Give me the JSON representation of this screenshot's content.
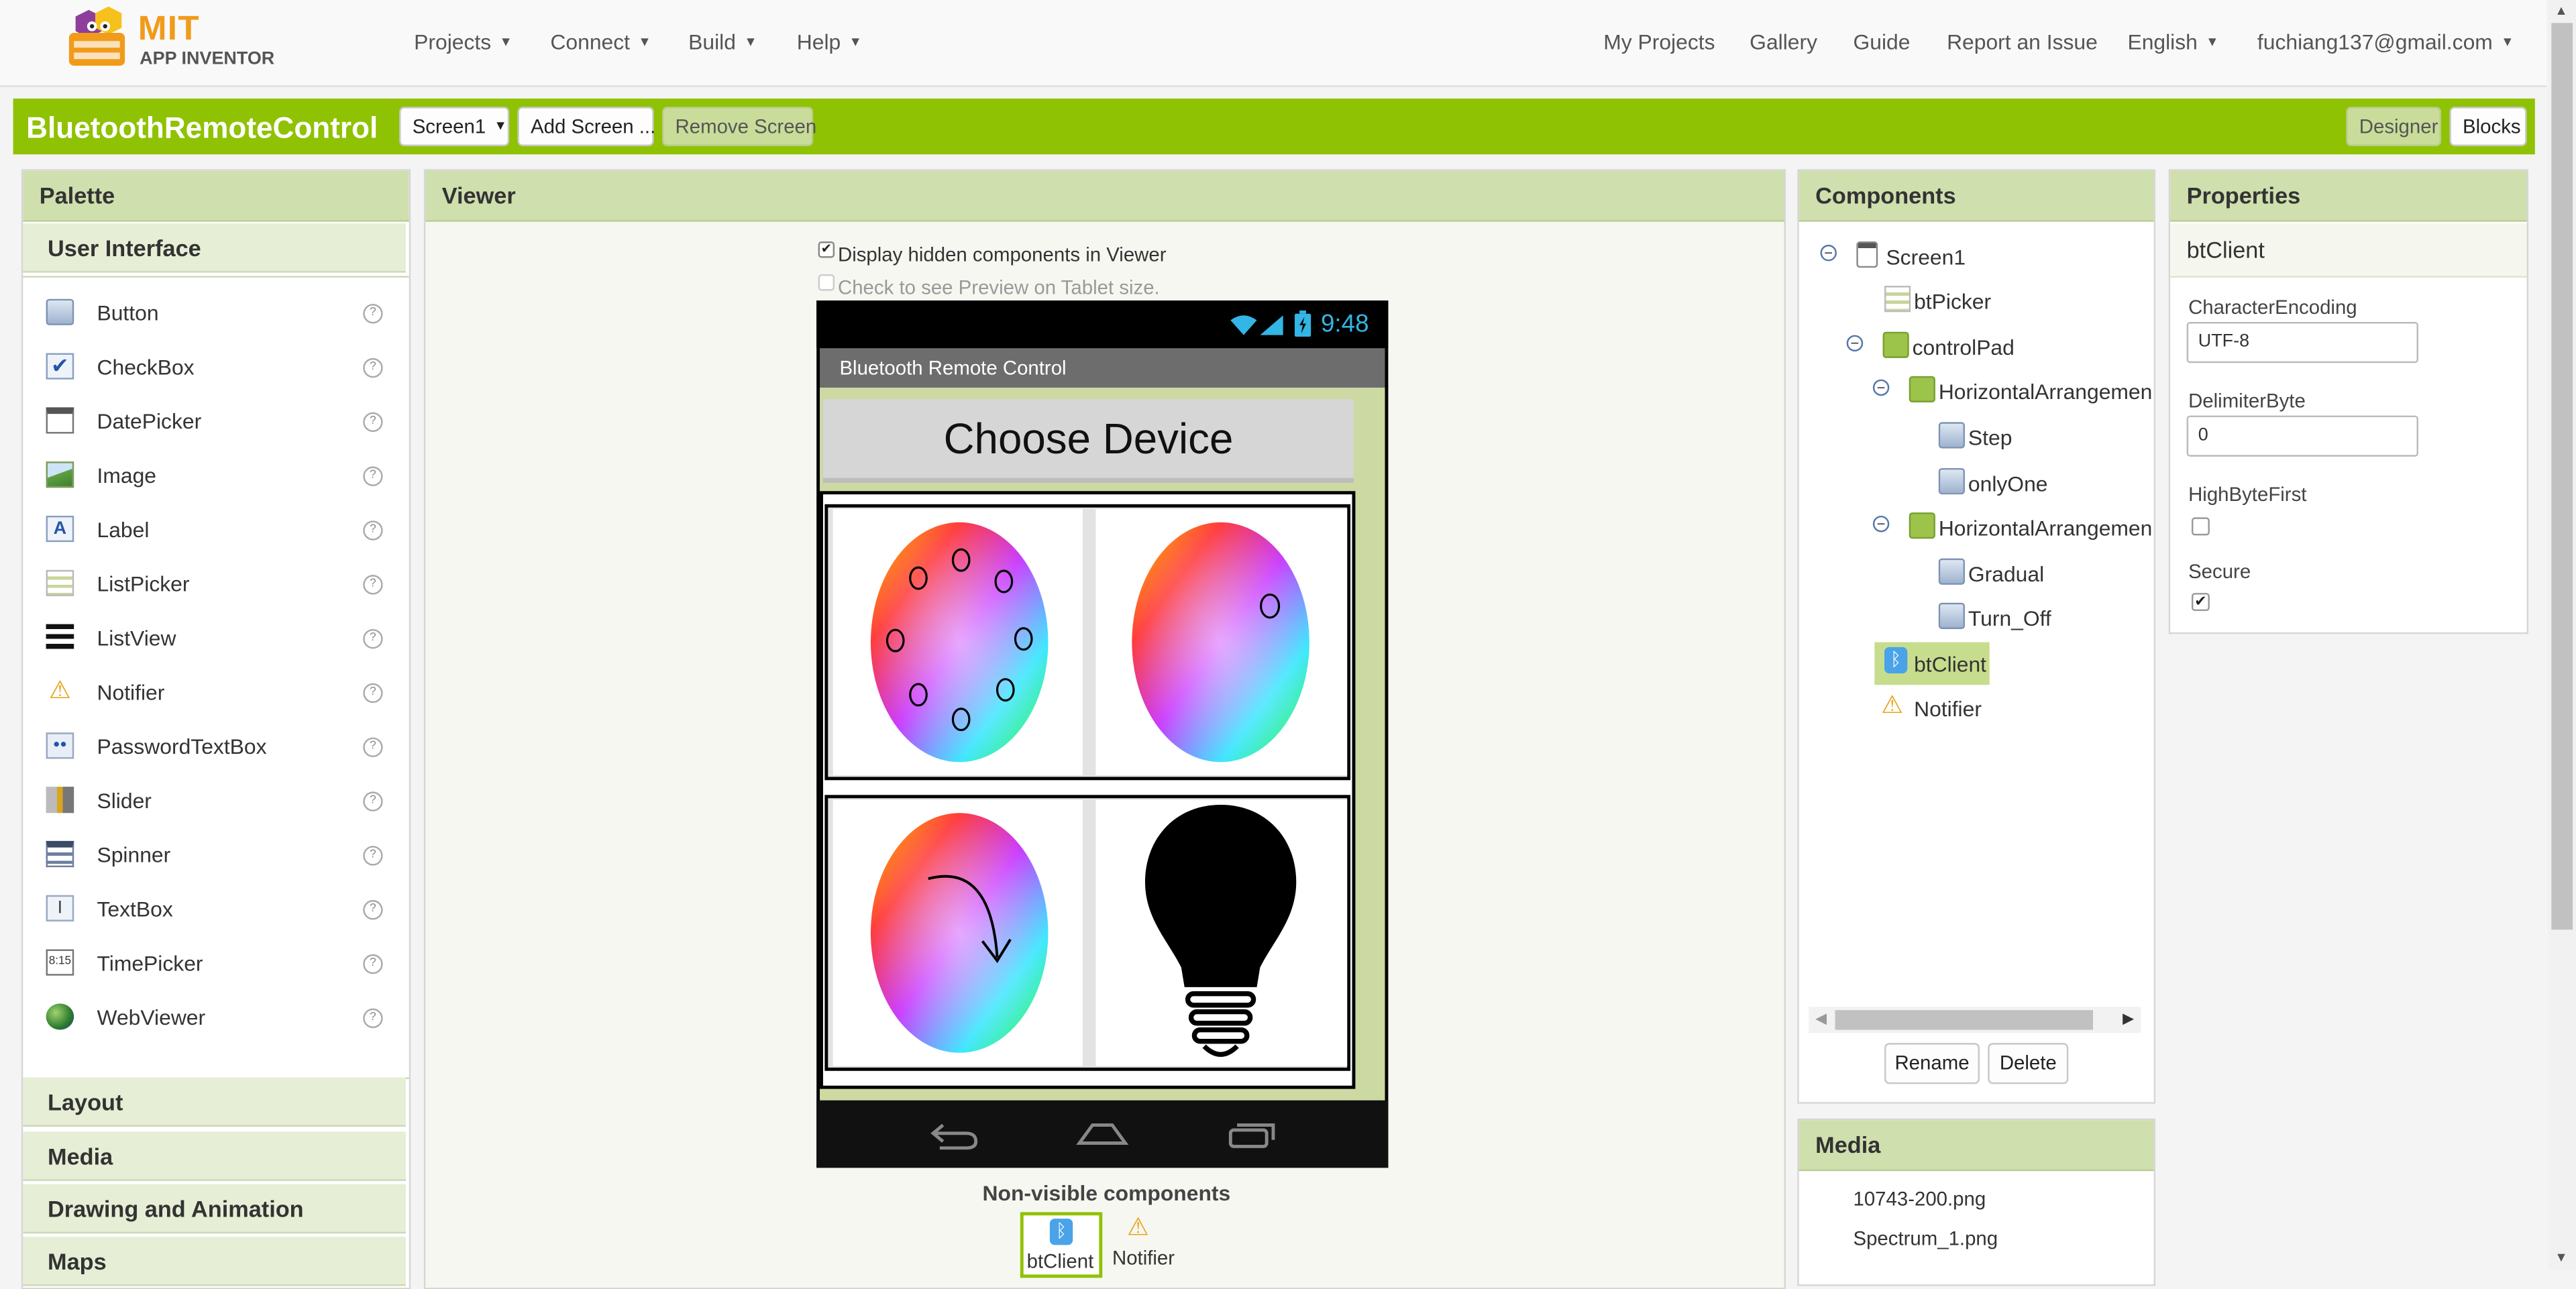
{
  "logo": {
    "line1": "MIT",
    "line2": "APP INVENTOR"
  },
  "topnav": {
    "menus": [
      "Projects",
      "Connect",
      "Build",
      "Help"
    ],
    "links": [
      "My Projects",
      "Gallery",
      "Guide",
      "Report an Issue"
    ],
    "language": "English",
    "account": "fuchiang137@gmail.com"
  },
  "project": {
    "name": "BluetoothRemoteControl",
    "screen_select": "Screen1",
    "add_screen": "Add Screen ...",
    "remove_screen": "Remove Screen",
    "designer": "Designer",
    "blocks": "Blocks"
  },
  "palette": {
    "title": "Palette",
    "open_category": "User Interface",
    "items": [
      {
        "label": "Button",
        "icon": "button-icon"
      },
      {
        "label": "CheckBox",
        "icon": "checkbox-icon"
      },
      {
        "label": "DatePicker",
        "icon": "datepicker-icon"
      },
      {
        "label": "Image",
        "icon": "image-icon"
      },
      {
        "label": "Label",
        "icon": "label-icon"
      },
      {
        "label": "ListPicker",
        "icon": "listpicker-icon"
      },
      {
        "label": "ListView",
        "icon": "listview-icon"
      },
      {
        "label": "Notifier",
        "icon": "notifier-icon"
      },
      {
        "label": "PasswordTextBox",
        "icon": "password-icon"
      },
      {
        "label": "Slider",
        "icon": "slider-icon"
      },
      {
        "label": "Spinner",
        "icon": "spinner-icon"
      },
      {
        "label": "TextBox",
        "icon": "textbox-icon"
      },
      {
        "label": "TimePicker",
        "icon": "timepicker-icon"
      },
      {
        "label": "WebViewer",
        "icon": "webviewer-icon"
      }
    ],
    "help_glyph": "?",
    "categories": [
      "Layout",
      "Media",
      "Drawing and Animation",
      "Maps"
    ]
  },
  "viewer": {
    "title": "Viewer",
    "display_hidden_label": "Display hidden components in Viewer",
    "display_hidden_checked": true,
    "tablet_preview_label": "Check to see Preview on Tablet size.",
    "tablet_preview_checked": false,
    "phone": {
      "time": "9:48",
      "app_title": "Bluetooth Remote Control",
      "button_text": "Choose Device"
    },
    "nonvisible_title": "Non-visible components",
    "nonvisible": [
      "btClient",
      "Notifier"
    ]
  },
  "components": {
    "title": "Components",
    "tree": [
      {
        "label": "Screen1",
        "icon": "screen-icon"
      },
      {
        "label": "btPicker",
        "icon": "listpicker-icon"
      },
      {
        "label": "controlPad",
        "icon": "vertical-arrangement-icon"
      },
      {
        "label": "HorizontalArrangemen",
        "icon": "horizontal-arrangement-icon"
      },
      {
        "label": "Step",
        "icon": "button-icon"
      },
      {
        "label": "onlyOne",
        "icon": "button-icon"
      },
      {
        "label": "HorizontalArrangemen",
        "icon": "horizontal-arrangement-icon"
      },
      {
        "label": "Gradual",
        "icon": "button-icon"
      },
      {
        "label": "Turn_Off",
        "icon": "button-icon"
      },
      {
        "label": "btClient",
        "icon": "bluetooth-icon"
      },
      {
        "label": "Notifier",
        "icon": "notifier-icon"
      }
    ],
    "selected": "btClient",
    "rename": "Rename",
    "delete": "Delete"
  },
  "media": {
    "title": "Media",
    "files": [
      "10743-200.png",
      "Spectrum_1.png"
    ]
  },
  "properties": {
    "title": "Properties",
    "component": "btClient",
    "character_encoding_label": "CharacterEncoding",
    "character_encoding_value": "UTF-8",
    "delimiter_byte_label": "DelimiterByte",
    "delimiter_byte_value": "0",
    "high_byte_first_label": "HighByteFirst",
    "high_byte_first_checked": false,
    "secure_label": "Secure",
    "secure_checked": true
  },
  "colors": {
    "brand_green": "#8fc202",
    "panel_header": "#cfdfae",
    "selection": "#c7dd8e"
  }
}
